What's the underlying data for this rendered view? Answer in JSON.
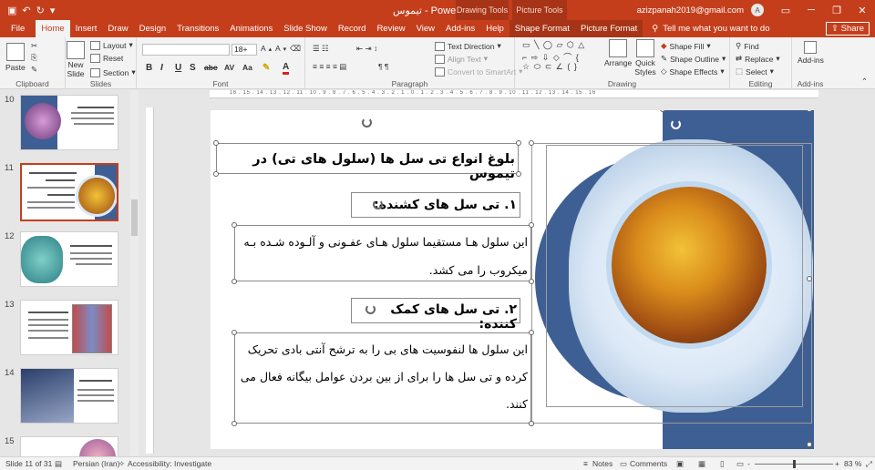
{
  "titlebar": {
    "title": "تیموس  -  PowerPoint",
    "context_drawing": "Drawing Tools",
    "context_picture": "Picture Tools",
    "user": "azizpanah2019@gmail.com",
    "avatar": "A",
    "save_icon": "save-icon",
    "undo_icon": "undo-icon",
    "redo_icon": "redo-icon"
  },
  "tabs": [
    "File",
    "Home",
    "Insert",
    "Draw",
    "Design",
    "Transitions",
    "Animations",
    "Slide Show",
    "Record",
    "Review",
    "View",
    "Add-ins",
    "Help",
    "Shape Format",
    "Picture Format"
  ],
  "tellme": "Tell me what you want to do",
  "share": "Share",
  "ribbon": {
    "clipboard": {
      "label": "Clipboard",
      "paste": "Paste"
    },
    "slides": {
      "label": "Slides",
      "new_slide": "New Slide",
      "layout": "Layout",
      "reset": "Reset",
      "section": "Section"
    },
    "font": {
      "label": "Font",
      "size": "18+",
      "bold": "B",
      "italic": "I",
      "underline": "U",
      "strike": "S",
      "abc": "abc",
      "color_a": "A"
    },
    "paragraph": {
      "label": "Paragraph",
      "text_direction": "Text Direction",
      "align_text": "Align Text",
      "smartart": "Convert to SmartArt"
    },
    "drawing": {
      "label": "Drawing",
      "arrange": "Arrange",
      "quick_styles": "Quick Styles",
      "shape_fill": "Shape Fill",
      "shape_outline": "Shape Outline",
      "shape_effects": "Shape Effects"
    },
    "editing": {
      "label": "Editing",
      "find": "Find",
      "replace": "Replace",
      "select": "Select"
    },
    "addins": {
      "label": "Add-ins",
      "addins_btn": "Add-ins"
    }
  },
  "thumbnails": [
    {
      "num": "10"
    },
    {
      "num": "11"
    },
    {
      "num": "12"
    },
    {
      "num": "13"
    },
    {
      "num": "14"
    },
    {
      "num": "15"
    }
  ],
  "ruler": "16 . 15 . 14 . 13 . 12 . 11 . 10 . 9 . 8 . 7 . 6 . 5 . 4 . 3 . 2 . 1 . 0 . 1 . 2 . 3 . 4 . 5 . 6 . 7 . 8 . 9 . 10 . 11 . 12 . 13 . 14 . 15 . 16",
  "slide": {
    "title": "بلوغ انواع تی سل ها (سلول های تی) در تیموس",
    "heading1": "۱. تی سل های کشنده:",
    "body1_line1": "این سلول هـا مستقیما سلول هـای عفـونی و آلـوده شـده بـه",
    "body1_line2": "میکروب را می کشد.",
    "heading2": "۲. تی سل های کمک کننده:",
    "body2_line1": "این سلول ها لنفوسیت های بی را به ترشح آنتی بادی تحریک",
    "body2_line2": "کرده و تی سل ها را برای از بین بردن عوامل بیگانه فعال می",
    "body2_line3": "کنند."
  },
  "status": {
    "slide_count": "Slide 11 of 31",
    "language": "Persian (Iran)",
    "accessibility": "Accessibility: Investigate",
    "notes": "Notes",
    "comments": "Comments",
    "zoom": "83 %",
    "zoom_minus": "-",
    "zoom_plus": "+"
  }
}
